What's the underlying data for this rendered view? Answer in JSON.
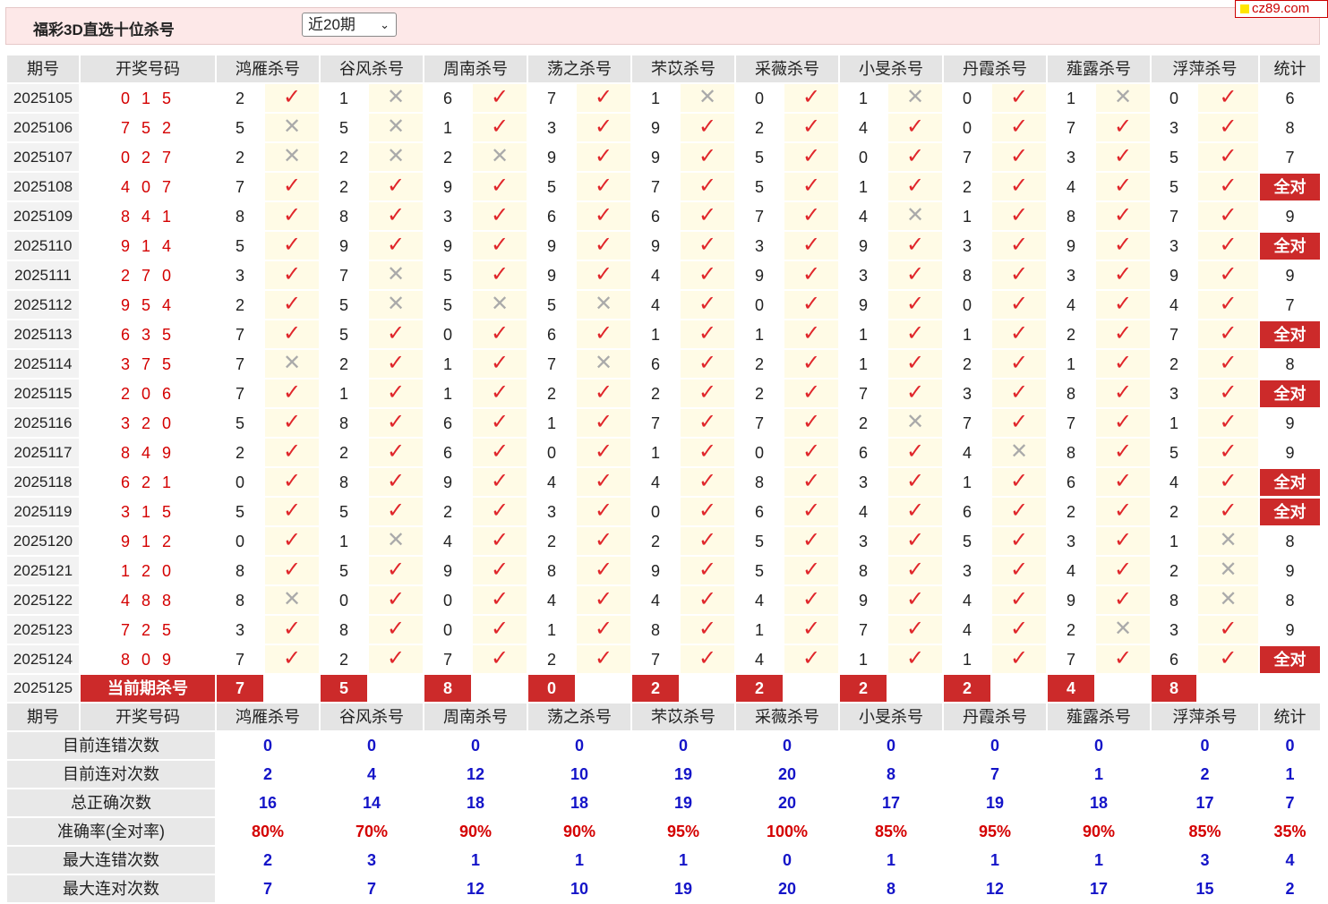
{
  "header": {
    "title": "福彩3D直选十位杀号",
    "range_select": "近20期",
    "watermark": "cz89.com"
  },
  "columns": {
    "issue": "期号",
    "draw": "开奖号码",
    "experts": [
      "鸿雁杀号",
      "谷风杀号",
      "周南杀号",
      "荡之杀号",
      "芣苡杀号",
      "采薇杀号",
      "小旻杀号",
      "丹霞杀号",
      "薤露杀号",
      "浮萍杀号"
    ],
    "stats": "统计"
  },
  "marks": {
    "hit": "✓",
    "miss": "✕"
  },
  "rows": [
    {
      "issue": "2025105",
      "draw": "0 1 5",
      "kills": [
        2,
        1,
        6,
        7,
        1,
        0,
        1,
        0,
        1,
        0
      ],
      "hits": [
        1,
        0,
        1,
        1,
        0,
        1,
        0,
        1,
        0,
        1
      ],
      "count": "6",
      "all": false
    },
    {
      "issue": "2025106",
      "draw": "7 5 2",
      "kills": [
        5,
        5,
        1,
        3,
        9,
        2,
        4,
        0,
        7,
        3
      ],
      "hits": [
        0,
        0,
        1,
        1,
        1,
        1,
        1,
        1,
        1,
        1
      ],
      "count": "8",
      "all": false
    },
    {
      "issue": "2025107",
      "draw": "0 2 7",
      "kills": [
        2,
        2,
        2,
        9,
        9,
        5,
        0,
        7,
        3,
        5
      ],
      "hits": [
        0,
        0,
        0,
        1,
        1,
        1,
        1,
        1,
        1,
        1
      ],
      "count": "7",
      "all": false
    },
    {
      "issue": "2025108",
      "draw": "4 0 7",
      "kills": [
        7,
        2,
        9,
        5,
        7,
        5,
        1,
        2,
        4,
        5
      ],
      "hits": [
        1,
        1,
        1,
        1,
        1,
        1,
        1,
        1,
        1,
        1
      ],
      "count": "全对",
      "all": true
    },
    {
      "issue": "2025109",
      "draw": "8 4 1",
      "kills": [
        8,
        8,
        3,
        6,
        6,
        7,
        4,
        1,
        8,
        7
      ],
      "hits": [
        1,
        1,
        1,
        1,
        1,
        1,
        0,
        1,
        1,
        1
      ],
      "count": "9",
      "all": false
    },
    {
      "issue": "2025110",
      "draw": "9 1 4",
      "kills": [
        5,
        9,
        9,
        9,
        9,
        3,
        9,
        3,
        9,
        3
      ],
      "hits": [
        1,
        1,
        1,
        1,
        1,
        1,
        1,
        1,
        1,
        1
      ],
      "count": "全对",
      "all": true
    },
    {
      "issue": "2025111",
      "draw": "2 7 0",
      "kills": [
        3,
        7,
        5,
        9,
        4,
        9,
        3,
        8,
        3,
        9
      ],
      "hits": [
        1,
        0,
        1,
        1,
        1,
        1,
        1,
        1,
        1,
        1
      ],
      "count": "9",
      "all": false
    },
    {
      "issue": "2025112",
      "draw": "9 5 4",
      "kills": [
        2,
        5,
        5,
        5,
        4,
        0,
        9,
        0,
        4,
        4
      ],
      "hits": [
        1,
        0,
        0,
        0,
        1,
        1,
        1,
        1,
        1,
        1
      ],
      "count": "7",
      "all": false
    },
    {
      "issue": "2025113",
      "draw": "6 3 5",
      "kills": [
        7,
        5,
        0,
        6,
        1,
        1,
        1,
        1,
        2,
        7
      ],
      "hits": [
        1,
        1,
        1,
        1,
        1,
        1,
        1,
        1,
        1,
        1
      ],
      "count": "全对",
      "all": true
    },
    {
      "issue": "2025114",
      "draw": "3 7 5",
      "kills": [
        7,
        2,
        1,
        7,
        6,
        2,
        1,
        2,
        1,
        2
      ],
      "hits": [
        0,
        1,
        1,
        0,
        1,
        1,
        1,
        1,
        1,
        1
      ],
      "count": "8",
      "all": false
    },
    {
      "issue": "2025115",
      "draw": "2 0 6",
      "kills": [
        7,
        1,
        1,
        2,
        2,
        2,
        7,
        3,
        8,
        3
      ],
      "hits": [
        1,
        1,
        1,
        1,
        1,
        1,
        1,
        1,
        1,
        1
      ],
      "count": "全对",
      "all": true
    },
    {
      "issue": "2025116",
      "draw": "3 2 0",
      "kills": [
        5,
        8,
        6,
        1,
        7,
        7,
        2,
        7,
        7,
        1
      ],
      "hits": [
        1,
        1,
        1,
        1,
        1,
        1,
        0,
        1,
        1,
        1
      ],
      "count": "9",
      "all": false
    },
    {
      "issue": "2025117",
      "draw": "8 4 9",
      "kills": [
        2,
        2,
        6,
        0,
        1,
        0,
        6,
        4,
        8,
        5
      ],
      "hits": [
        1,
        1,
        1,
        1,
        1,
        1,
        1,
        0,
        1,
        1
      ],
      "count": "9",
      "all": false
    },
    {
      "issue": "2025118",
      "draw": "6 2 1",
      "kills": [
        0,
        8,
        9,
        4,
        4,
        8,
        3,
        1,
        6,
        4
      ],
      "hits": [
        1,
        1,
        1,
        1,
        1,
        1,
        1,
        1,
        1,
        1
      ],
      "count": "全对",
      "all": true
    },
    {
      "issue": "2025119",
      "draw": "3 1 5",
      "kills": [
        5,
        5,
        2,
        3,
        0,
        6,
        4,
        6,
        2,
        2
      ],
      "hits": [
        1,
        1,
        1,
        1,
        1,
        1,
        1,
        1,
        1,
        1
      ],
      "count": "全对",
      "all": true
    },
    {
      "issue": "2025120",
      "draw": "9 1 2",
      "kills": [
        0,
        1,
        4,
        2,
        2,
        5,
        3,
        5,
        3,
        1
      ],
      "hits": [
        1,
        0,
        1,
        1,
        1,
        1,
        1,
        1,
        1,
        0
      ],
      "count": "8",
      "all": false
    },
    {
      "issue": "2025121",
      "draw": "1 2 0",
      "kills": [
        8,
        5,
        9,
        8,
        9,
        5,
        8,
        3,
        4,
        2
      ],
      "hits": [
        1,
        1,
        1,
        1,
        1,
        1,
        1,
        1,
        1,
        0
      ],
      "count": "9",
      "all": false
    },
    {
      "issue": "2025122",
      "draw": "4 8 8",
      "kills": [
        8,
        0,
        0,
        4,
        4,
        4,
        9,
        4,
        9,
        8
      ],
      "hits": [
        0,
        1,
        1,
        1,
        1,
        1,
        1,
        1,
        1,
        0
      ],
      "count": "8",
      "all": false
    },
    {
      "issue": "2025123",
      "draw": "7 2 5",
      "kills": [
        3,
        8,
        0,
        1,
        8,
        1,
        7,
        4,
        2,
        3
      ],
      "hits": [
        1,
        1,
        1,
        1,
        1,
        1,
        1,
        1,
        0,
        1
      ],
      "count": "9",
      "all": false
    },
    {
      "issue": "2025124",
      "draw": "8 0 9",
      "kills": [
        7,
        2,
        7,
        2,
        7,
        4,
        1,
        1,
        7,
        6
      ],
      "hits": [
        1,
        1,
        1,
        1,
        1,
        1,
        1,
        1,
        1,
        1
      ],
      "count": "全对",
      "all": true
    }
  ],
  "current": {
    "issue": "2025125",
    "label": "当前期杀号",
    "kills": [
      7,
      5,
      8,
      0,
      2,
      2,
      2,
      2,
      4,
      8
    ]
  },
  "stats": [
    {
      "label": "目前连错次数",
      "values": [
        "0",
        "0",
        "0",
        "0",
        "0",
        "0",
        "0",
        "0",
        "0",
        "0"
      ],
      "total": "0",
      "color": "blue"
    },
    {
      "label": "目前连对次数",
      "values": [
        "2",
        "4",
        "12",
        "10",
        "19",
        "20",
        "8",
        "7",
        "1",
        "2"
      ],
      "total": "1",
      "color": "blue"
    },
    {
      "label": "总正确次数",
      "values": [
        "16",
        "14",
        "18",
        "18",
        "19",
        "20",
        "17",
        "19",
        "18",
        "17"
      ],
      "total": "7",
      "color": "blue"
    },
    {
      "label": "准确率(全对率)",
      "values": [
        "80%",
        "70%",
        "90%",
        "90%",
        "95%",
        "100%",
        "85%",
        "95%",
        "90%",
        "85%"
      ],
      "total": "35%",
      "color": "red"
    },
    {
      "label": "最大连错次数",
      "values": [
        "2",
        "3",
        "1",
        "1",
        "1",
        "0",
        "1",
        "1",
        "1",
        "3"
      ],
      "total": "4",
      "color": "blue"
    },
    {
      "label": "最大连对次数",
      "values": [
        "7",
        "7",
        "12",
        "10",
        "19",
        "20",
        "8",
        "12",
        "17",
        "15"
      ],
      "total": "2",
      "color": "blue"
    }
  ]
}
